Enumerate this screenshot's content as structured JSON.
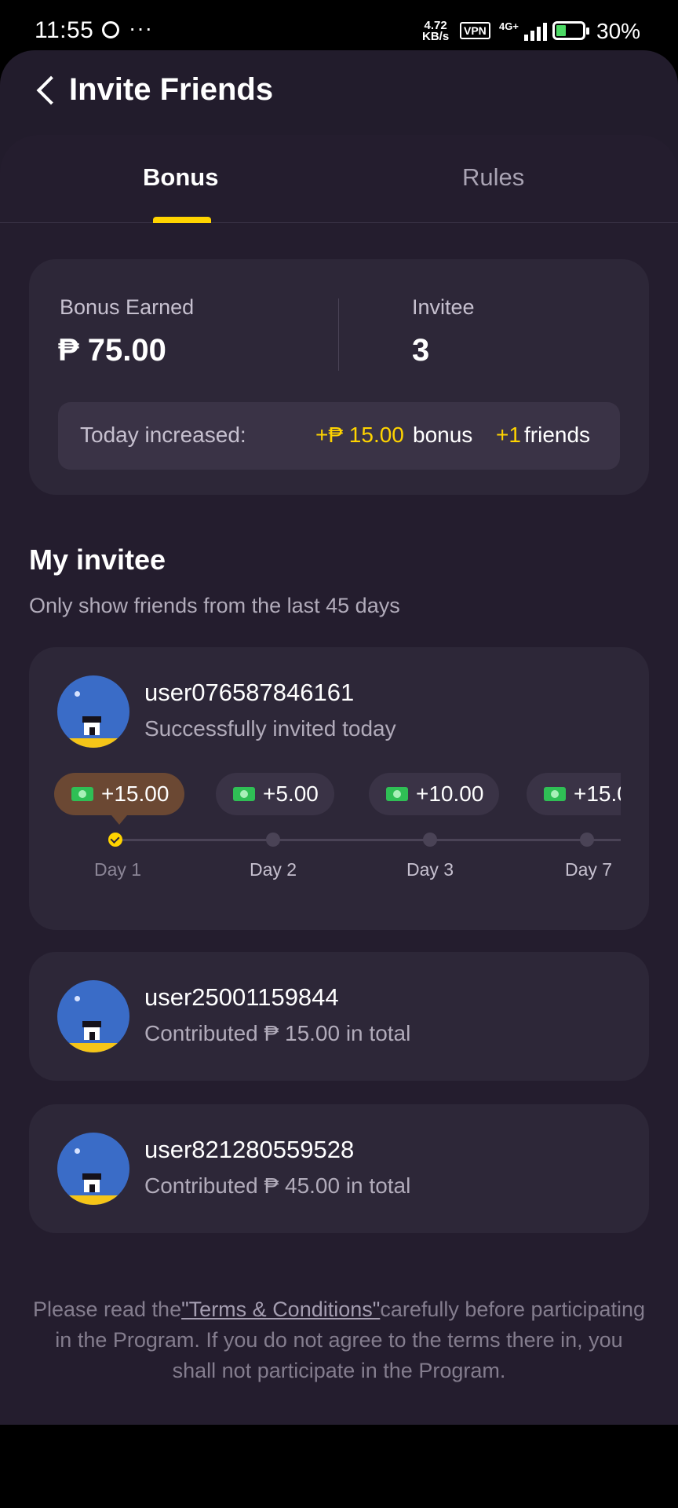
{
  "status_bar": {
    "time": "11:55",
    "dots": "···",
    "speed_value": "4.72",
    "speed_unit": "KB/s",
    "vpn": "VPN",
    "network": "4G+",
    "battery": "30%",
    "icons": [
      "message-icon",
      "vpn-icon",
      "signal-icon",
      "battery-icon"
    ]
  },
  "header": {
    "title": "Invite Friends",
    "back_icon": "chevron-left-icon"
  },
  "tabs": [
    {
      "label": "Bonus",
      "active": true
    },
    {
      "label": "Rules",
      "active": false
    }
  ],
  "summary": {
    "bonus_label": "Bonus Earned",
    "bonus_value": "₱ 75.00",
    "invitee_label": "Invitee",
    "invitee_value": "3",
    "today_label": "Today increased:",
    "today_bonus": "+₱ 15.00",
    "today_bonus_word": "bonus",
    "today_friends": "+1",
    "today_friends_word": "friends"
  },
  "my_invitee": {
    "title": "My invitee",
    "subtitle": "Only show friends from the last 45 days"
  },
  "invitees": [
    {
      "name": "user076587846161",
      "status": "Successfully invited today",
      "rewards": [
        {
          "amount": "+15.00",
          "day": "Day 1",
          "active": true
        },
        {
          "amount": "+5.00",
          "day": "Day 2",
          "active": false
        },
        {
          "amount": "+10.00",
          "day": "Day 3",
          "active": false
        },
        {
          "amount": "+15.0",
          "day": "Day 7",
          "active": false
        }
      ]
    },
    {
      "name": "user25001159844",
      "status": "Contributed ₱ 15.00 in total"
    },
    {
      "name": "user821280559528",
      "status": "Contributed ₱ 45.00 in total"
    }
  ],
  "terms": {
    "before": "Please read the",
    "link": "\"Terms & Conditions\"",
    "after": "carefully before participating in the Program. If you do not agree to the terms there in, you shall not participate in the Program."
  },
  "colors": {
    "accent": "#ffd400",
    "card": "#2d2738",
    "background": "#241d2e",
    "active_pill": "#6b4833"
  }
}
